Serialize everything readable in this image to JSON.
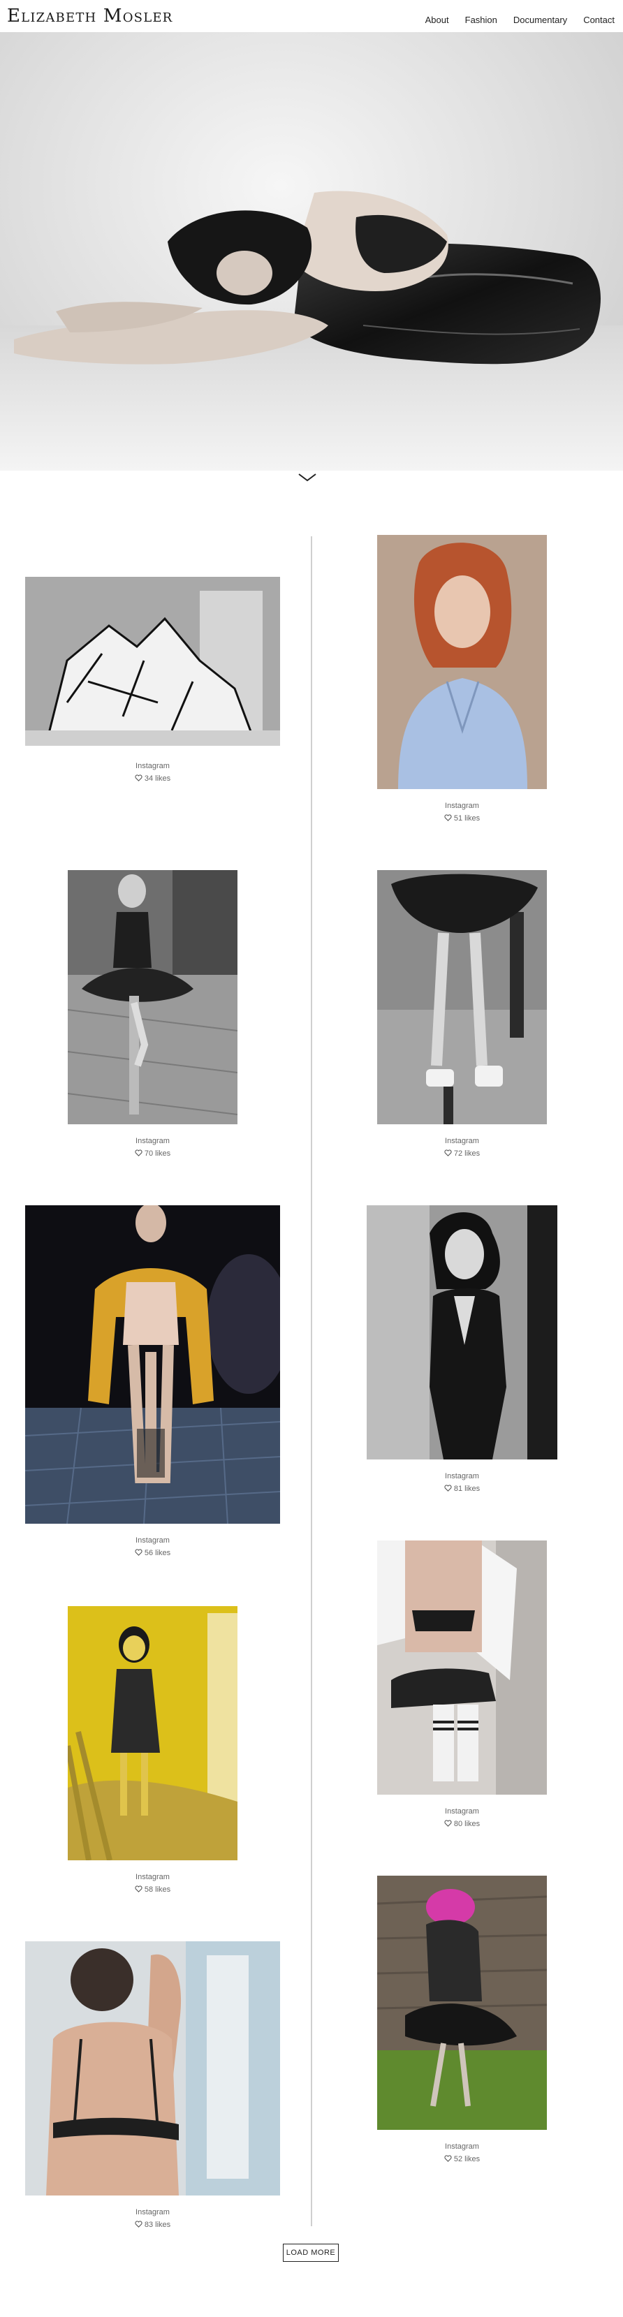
{
  "header": {
    "logo": "Elizabeth Mosler",
    "nav": [
      "About",
      "Fashion",
      "Documentary",
      "Contact"
    ]
  },
  "hero": {
    "alt": "black and white portrait"
  },
  "posts": [
    {
      "source": "Instagram",
      "likes": "34 likes"
    },
    {
      "source": "Instagram",
      "likes": "51 likes"
    },
    {
      "source": "Instagram",
      "likes": "70 likes"
    },
    {
      "source": "Instagram",
      "likes": "72 likes"
    },
    {
      "source": "Instagram",
      "likes": "56 likes"
    },
    {
      "source": "Instagram",
      "likes": "81 likes"
    },
    {
      "source": "Instagram",
      "likes": "58 likes"
    },
    {
      "source": "Instagram",
      "likes": "80 likes"
    },
    {
      "source": "Instagram",
      "likes": "83 likes"
    },
    {
      "source": "Instagram",
      "likes": "52 likes"
    }
  ],
  "load_more": "LOAD MORE",
  "colors": {
    "text": "#222222",
    "muted": "#666666",
    "line": "#cfcfcf"
  }
}
